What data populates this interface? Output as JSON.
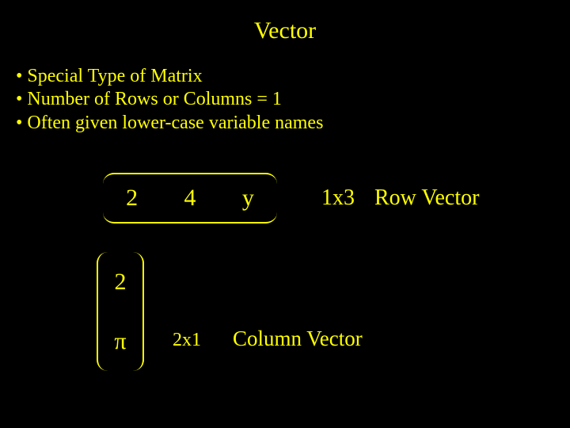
{
  "title": "Vector",
  "bullets": [
    "Special Type of Matrix",
    "Number of Rows or Columns = 1",
    "Often given lower-case variable names"
  ],
  "row_vector": {
    "cells": [
      "2",
      "4",
      "y"
    ],
    "dim": "1x3",
    "label": "Row Vector"
  },
  "col_vector": {
    "cells": [
      "2",
      "π"
    ],
    "dim": "2x1",
    "label": "Column Vector"
  }
}
